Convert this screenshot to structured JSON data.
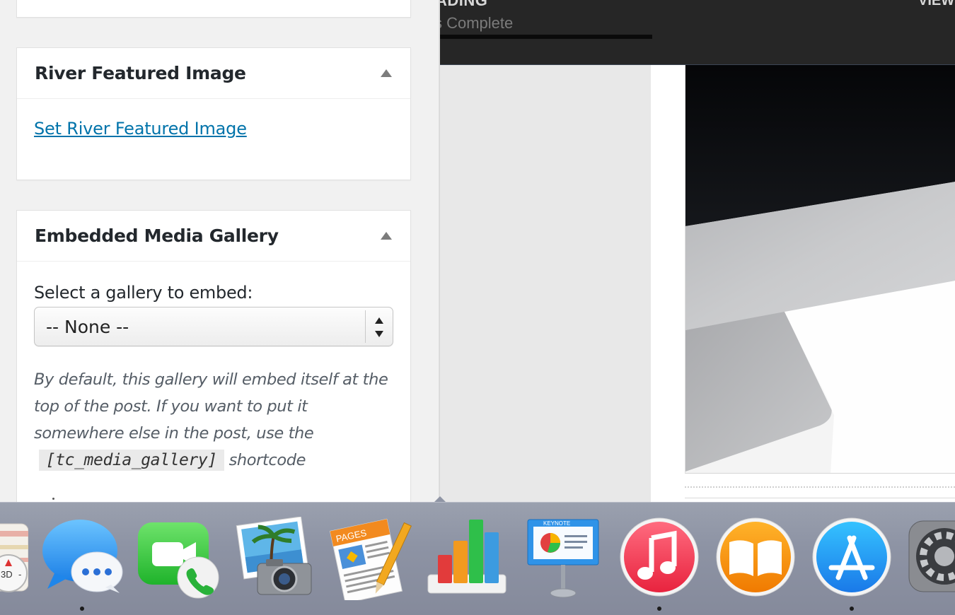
{
  "preview": {
    "loading_title": "ADING",
    "loading_subtitle": "s Complete",
    "view_label": "VIEW",
    "progress_fraction": 1.0
  },
  "metaboxes": {
    "river": {
      "title": "River Featured Image",
      "link_text": "Set River Featured Image"
    },
    "gallery": {
      "title": "Embedded Media Gallery",
      "select_label": "Select a gallery to embed:",
      "select_value": "-- None --",
      "help_text_before": "By default, this gallery will embed itself at the top of the post. If you want to put it somewhere else in the post, use the",
      "shortcode": "[tc_media_gallery]",
      "help_text_after": "shortcode"
    }
  },
  "dock": {
    "items": [
      {
        "name": "Maps",
        "icon": "maps-icon",
        "badge_text": "3D",
        "running": false
      },
      {
        "name": "Messages",
        "icon": "messages-icon",
        "running": true
      },
      {
        "name": "FaceTime",
        "icon": "facetime-icon",
        "running": false
      },
      {
        "name": "iPhoto",
        "icon": "iphoto-icon",
        "running": false
      },
      {
        "name": "Pages",
        "icon": "pages-icon",
        "badge_text": "PAGES",
        "running": false
      },
      {
        "name": "Numbers",
        "icon": "numbers-icon",
        "running": false
      },
      {
        "name": "Keynote",
        "icon": "keynote-icon",
        "badge_text": "KEYNOTE",
        "running": false
      },
      {
        "name": "iTunes",
        "icon": "itunes-icon",
        "running": true
      },
      {
        "name": "iBooks",
        "icon": "ibooks-icon",
        "running": false
      },
      {
        "name": "App Store",
        "icon": "app-store-icon",
        "running": true
      },
      {
        "name": "System Preferences",
        "icon": "system-preferences-icon",
        "running": false
      }
    ]
  },
  "colors": {
    "link": "#0073aa",
    "loading_bar_bg": "#262626",
    "dock_bg": "#8d93a4"
  }
}
